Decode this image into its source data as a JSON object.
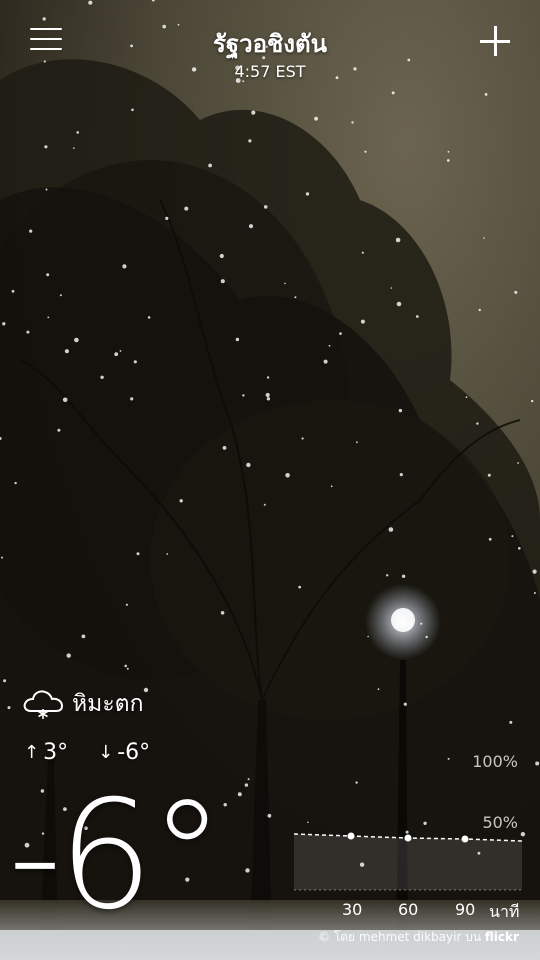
{
  "header": {
    "location": "รัฐวอชิงตัน",
    "time": "4:57 EST"
  },
  "current": {
    "condition": "หิมะตก",
    "condition_icon": "snow-cloud-icon",
    "high": "3°",
    "low": "-6°",
    "temperature": "-6°"
  },
  "precipitation": {
    "pct_100": "100%",
    "pct_50": "50%",
    "minute_marks": [
      "30",
      "60",
      "90"
    ],
    "unit": "นาที"
  },
  "photo_credit": {
    "prefix": "© โดย mehmet dikbayir บน",
    "brand": "flickr"
  },
  "colors": {
    "sky": "#5a533f",
    "foliage": "#1c1a12",
    "text": "#ffffff"
  }
}
